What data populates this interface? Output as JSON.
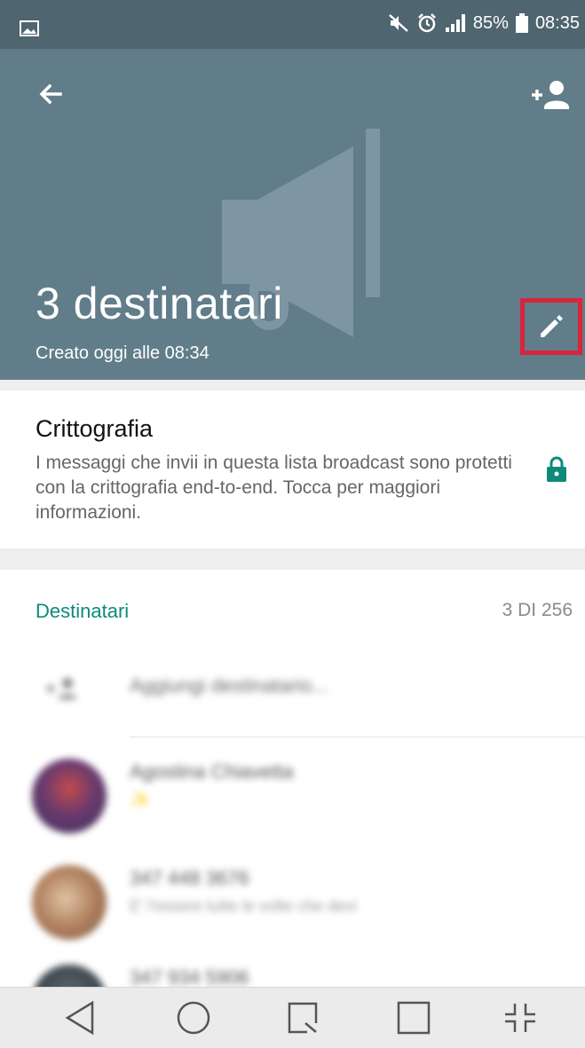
{
  "status_bar": {
    "battery": "85%",
    "time": "08:35",
    "icons": [
      "image-icon",
      "mute-icon",
      "alarm-icon",
      "signal-icon",
      "battery-icon"
    ]
  },
  "header": {
    "title": "3 destinatari",
    "subtitle": "Creato oggi alle 08:34",
    "icons": [
      "back-arrow-icon",
      "add-person-icon",
      "megaphone-icon",
      "pencil-icon"
    ],
    "background_color": "#617d89",
    "highlight_color": "#d9243b"
  },
  "encryption": {
    "title": "Crittografia",
    "description": "I messaggi che invii in questa lista broadcast sono protetti con la crittografia end-to-end. Tocca per maggiori informazioni.",
    "icon": "lock-icon",
    "accent_color": "#0e8a7c"
  },
  "recipients": {
    "heading": "Destinatari",
    "count": "3 DI 256",
    "add_label": "Aggiungi destinatario...",
    "contacts": [
      {
        "name": "Agostina Chiavetta",
        "status": "✨"
      },
      {
        "name": "347 448 3676",
        "status": "E' l'essere tutte le volte che devi"
      },
      {
        "name": "347 934 5906",
        "status": ""
      }
    ]
  },
  "nav_bar": {
    "buttons": [
      "back-triangle-icon",
      "home-circle-icon",
      "recents-icon",
      "square-icon",
      "collapse-icon"
    ]
  }
}
